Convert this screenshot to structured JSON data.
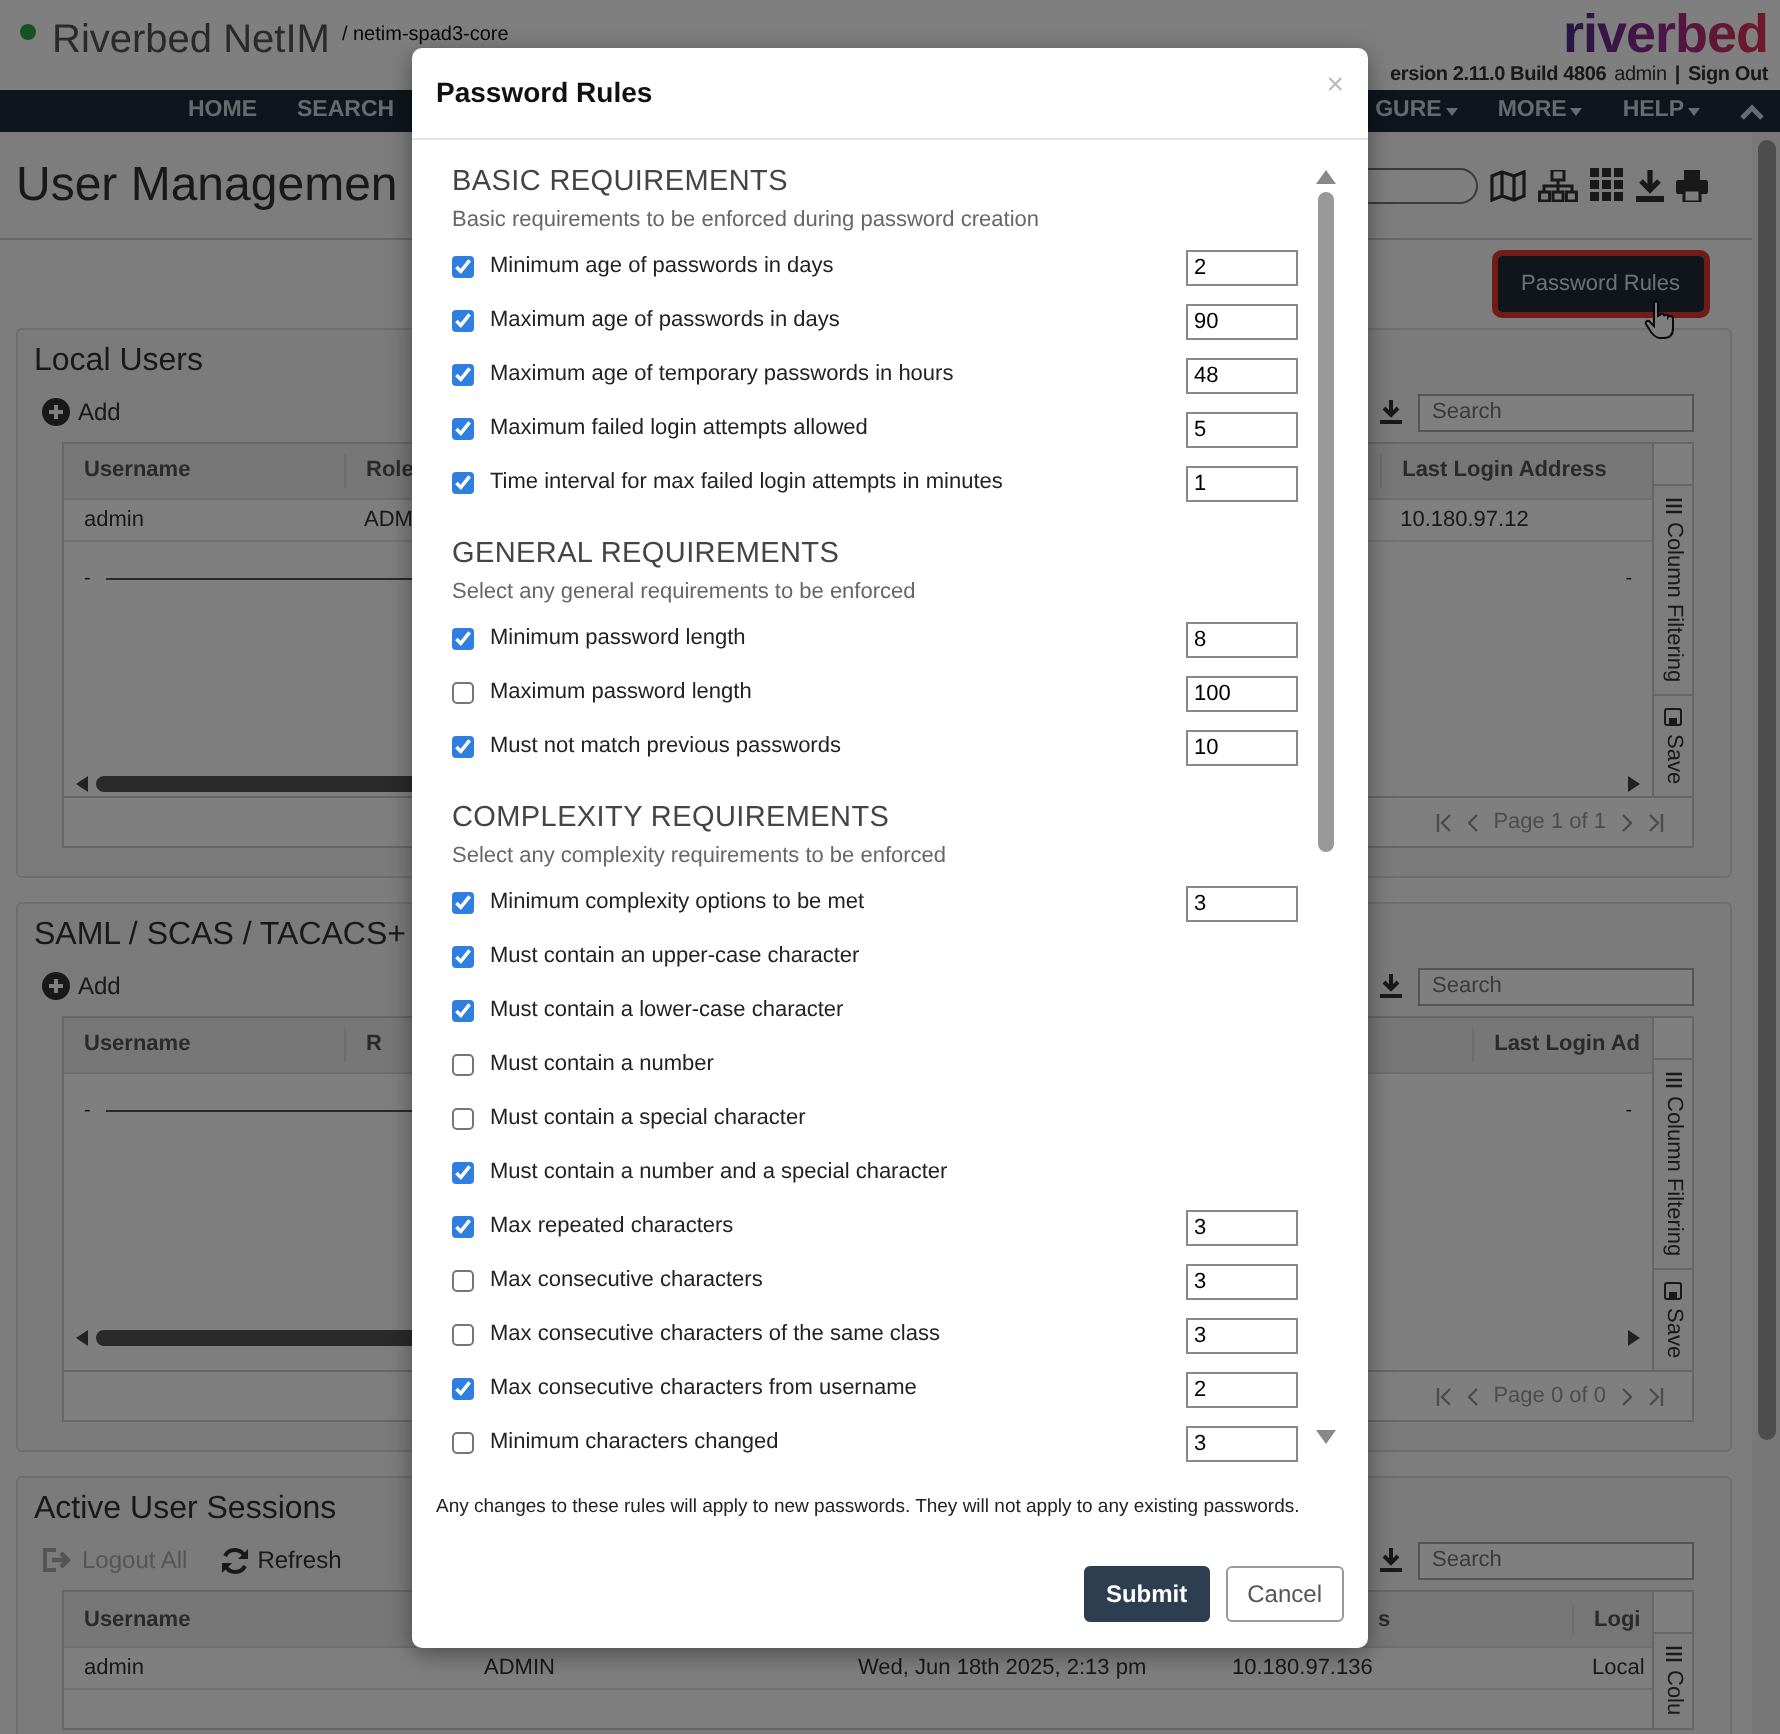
{
  "header": {
    "app_name": "Riverbed NetIM",
    "server": "/ netim-spad3-core",
    "version": "ersion 2.11.0 Build 4806",
    "user": "admin",
    "separator": "|",
    "sign_out": "Sign Out",
    "logo": "riverbed"
  },
  "nav": {
    "left": [
      {
        "label": "HOME",
        "dropdown": false
      },
      {
        "label": "SEARCH",
        "dropdown": false
      }
    ],
    "right": [
      {
        "label": "GURE",
        "dropdown": true
      },
      {
        "label": "MORE",
        "dropdown": true
      },
      {
        "label": "HELP",
        "dropdown": true
      }
    ]
  },
  "page_title": "User Managemen",
  "password_rules_button": {
    "label": "Password Rules",
    "highlighted": true
  },
  "panels": [
    {
      "title": "Local Users",
      "actions": [
        {
          "label": "Add",
          "kind": "add",
          "disabled": false
        }
      ],
      "search_placeholder": "Search",
      "columns": [
        "Username",
        "Role",
        "Last Login Address"
      ],
      "rows": [
        [
          "admin",
          "ADM",
          "10.180.97.12"
        ]
      ],
      "filler_row": [
        "-",
        "-"
      ],
      "side_tabs": [
        "Column Filtering",
        "Save"
      ],
      "pager": "Page 1 of 1"
    },
    {
      "title": "SAML / SCAS / TACACS+",
      "actions": [
        {
          "label": "Add",
          "kind": "add",
          "disabled": false
        }
      ],
      "search_placeholder": "Search",
      "columns": [
        "Username",
        "R",
        "Last Login Ad"
      ],
      "filler_row": [
        "-",
        "-"
      ],
      "side_tabs": [
        "Column Filtering",
        "Save"
      ],
      "pager": "Page 0 of 0"
    },
    {
      "title": "Active User Sessions",
      "actions": [
        {
          "label": "Logout All",
          "kind": "logout",
          "disabled": true
        },
        {
          "label": "Refresh",
          "kind": "refresh",
          "disabled": false
        }
      ],
      "search_placeholder": "Search",
      "columns": [
        "Username",
        "",
        "",
        "s",
        "Logi"
      ],
      "rows": [
        [
          "admin",
          "ADMIN",
          "Wed, Jun 18th 2025, 2:13 pm",
          "10.180.97.136",
          "Local"
        ]
      ],
      "side_tabs": [
        "Colu"
      ]
    }
  ],
  "modal": {
    "title": "Password Rules",
    "close": "×",
    "sections": [
      {
        "heading": "BASIC REQUIREMENTS",
        "description": "Basic requirements to be enforced during password creation",
        "rules": [
          {
            "label": "Minimum age of passwords in days",
            "checked": true,
            "value": "2"
          },
          {
            "label": "Maximum age of passwords in days",
            "checked": true,
            "value": "90"
          },
          {
            "label": "Maximum age of temporary passwords in hours",
            "checked": true,
            "value": "48"
          },
          {
            "label": "Maximum failed login attempts allowed",
            "checked": true,
            "value": "5"
          },
          {
            "label": "Time interval for max failed login attempts in minutes",
            "checked": true,
            "value": "1"
          }
        ]
      },
      {
        "heading": "GENERAL REQUIREMENTS",
        "description": "Select any general requirements to be enforced",
        "rules": [
          {
            "label": "Minimum password length",
            "checked": true,
            "value": "8"
          },
          {
            "label": "Maximum password length",
            "checked": false,
            "value": "100"
          },
          {
            "label": "Must not match previous passwords",
            "checked": true,
            "value": "10"
          }
        ]
      },
      {
        "heading": "COMPLEXITY REQUIREMENTS",
        "description": "Select any complexity requirements to be enforced",
        "rules": [
          {
            "label": "Minimum complexity options to be met",
            "checked": true,
            "value": "3"
          },
          {
            "label": "Must contain an upper-case character",
            "checked": true
          },
          {
            "label": "Must contain a lower-case character",
            "checked": true
          },
          {
            "label": "Must contain a number",
            "checked": false
          },
          {
            "label": "Must contain a special character",
            "checked": false
          },
          {
            "label": "Must contain a number and a special character",
            "checked": true
          },
          {
            "label": "Max repeated characters",
            "checked": true,
            "value": "3"
          },
          {
            "label": "Max consecutive characters",
            "checked": false,
            "value": "3"
          },
          {
            "label": "Max consecutive characters of the same class",
            "checked": false,
            "value": "3"
          },
          {
            "label": "Max consecutive characters from username",
            "checked": true,
            "value": "2"
          },
          {
            "label": "Minimum characters changed",
            "checked": false,
            "value": "3"
          }
        ]
      }
    ],
    "note": "Any changes to these rules will apply to new passwords. They will not apply to any existing passwords.",
    "buttons": [
      {
        "label": "Submit",
        "kind": "primary"
      },
      {
        "label": "Cancel",
        "kind": "secondary"
      }
    ]
  }
}
